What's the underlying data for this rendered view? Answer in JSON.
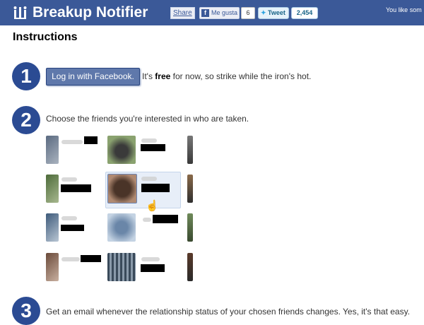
{
  "header": {
    "brand": "Breakup Notifier",
    "share_label": "Share",
    "like_label": "Me gusta",
    "like_count": "6",
    "tweet_label": "Tweet",
    "tweet_count": "2,454",
    "top_right_text": "You like som"
  },
  "instructions": {
    "heading": "Instructions",
    "step1": {
      "number": "1",
      "login_label": "Log in with Facebook.",
      "text_before": "It's ",
      "text_bold": "free",
      "text_after": " for now, so strike while the iron's hot."
    },
    "step2": {
      "number": "2",
      "text": "Choose the friends you're interested in who are taken."
    },
    "step3": {
      "number": "3",
      "text": "Get an email whenever the relationship status of your chosen friends changes. Yes, it's that easy."
    }
  },
  "colors": {
    "brand_blue": "#3b5998",
    "step_blue": "#2b4b93",
    "selection_bg": "#e7eef8"
  }
}
